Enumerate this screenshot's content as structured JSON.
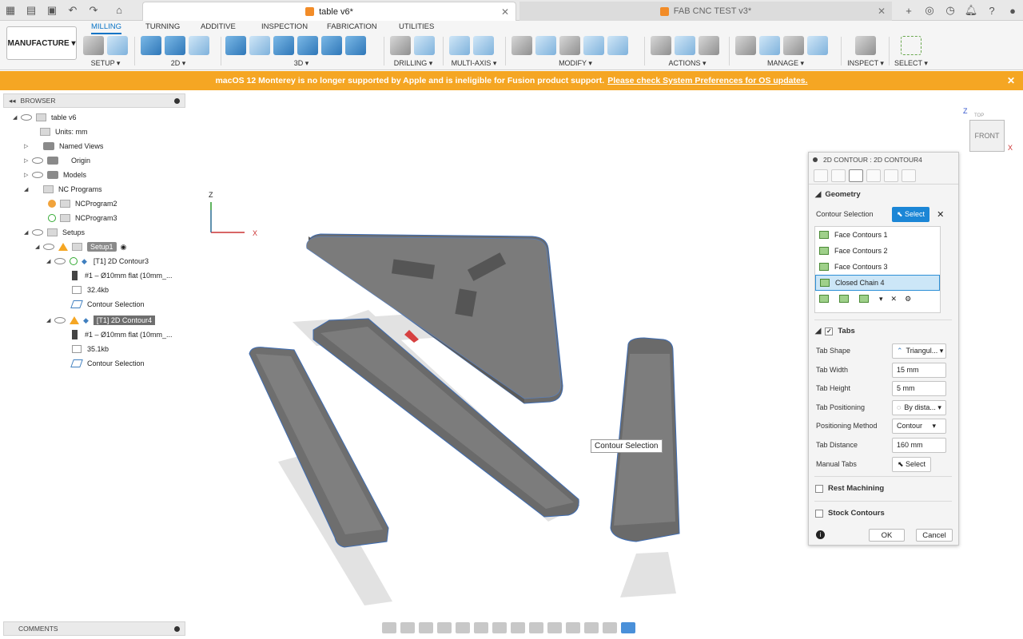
{
  "titlebar": {
    "active_tab": "table v6*",
    "second_tab": "FAB CNC TEST v3*"
  },
  "ribbon": {
    "workspace": "MANUFACTURE",
    "tabs": [
      {
        "label": "MILLING",
        "active": true
      },
      {
        "label": "TURNING"
      },
      {
        "label": "ADDITIVE"
      },
      {
        "label": "INSPECTION"
      },
      {
        "label": "FABRICATION"
      },
      {
        "label": "UTILITIES"
      }
    ],
    "groups": [
      "SETUP",
      "2D",
      "3D",
      "DRILLING",
      "MULTI-AXIS",
      "MODIFY",
      "ACTIONS",
      "MANAGE",
      "INSPECT",
      "SELECT"
    ]
  },
  "banner": {
    "text": "macOS 12 Monterey is no longer supported by Apple and is ineligible for Fusion product support.",
    "link": "Please check System Preferences for OS updates."
  },
  "browser": {
    "title": "BROWSER",
    "items": [
      "table v6",
      "Units: mm",
      "Named Views",
      "Origin",
      "Models",
      "NC Programs",
      "NCProgram2",
      "NCProgram3",
      "Setups",
      "Setup1",
      "[T1] 2D Contour3",
      "#1 – Ø10mm flat (10mm_...",
      "32.4kb",
      "Contour Selection",
      "[T1] 2D Contour4",
      "#1 – Ø10mm flat (10mm_...",
      "35.1kb",
      "Contour Selection"
    ]
  },
  "comments": {
    "title": "COMMENTS"
  },
  "viewport": {
    "axis_z": "Z",
    "axis_x": "X",
    "tooltip": "Contour Selection",
    "viewcube_face": "FRONT",
    "viewcube_top": "TOP",
    "viewcube_z": "Z",
    "viewcube_x": "X"
  },
  "dialog": {
    "title": "2D CONTOUR : 2D CONTOUR4",
    "geometry_label": "Geometry",
    "contour_selection_label": "Contour Selection",
    "select_label": "Select",
    "contours": [
      "Face Contours 1",
      "Face Contours 2",
      "Face Contours 3",
      "Closed Chain 4"
    ],
    "tabs_label": "Tabs",
    "tab_shape_label": "Tab Shape",
    "tab_shape_value": "Triangul...",
    "tab_width_label": "Tab Width",
    "tab_width_value": "15 mm",
    "tab_height_label": "Tab Height",
    "tab_height_value": "5 mm",
    "tab_positioning_label": "Tab Positioning",
    "tab_positioning_value": "By dista...",
    "positioning_method_label": "Positioning Method",
    "positioning_method_value": "Contour",
    "tab_distance_label": "Tab Distance",
    "tab_distance_value": "160 mm",
    "manual_tabs_label": "Manual Tabs",
    "manual_tabs_select": "Select",
    "rest_machining_label": "Rest Machining",
    "stock_contours_label": "Stock Contours",
    "ok": "OK",
    "cancel": "Cancel"
  },
  "colors": {
    "banner": "#f5a623",
    "accent": "#0a74c6",
    "select_button": "#1b86d6",
    "part": "#7b7b7b",
    "edge": "#3f6db3"
  }
}
